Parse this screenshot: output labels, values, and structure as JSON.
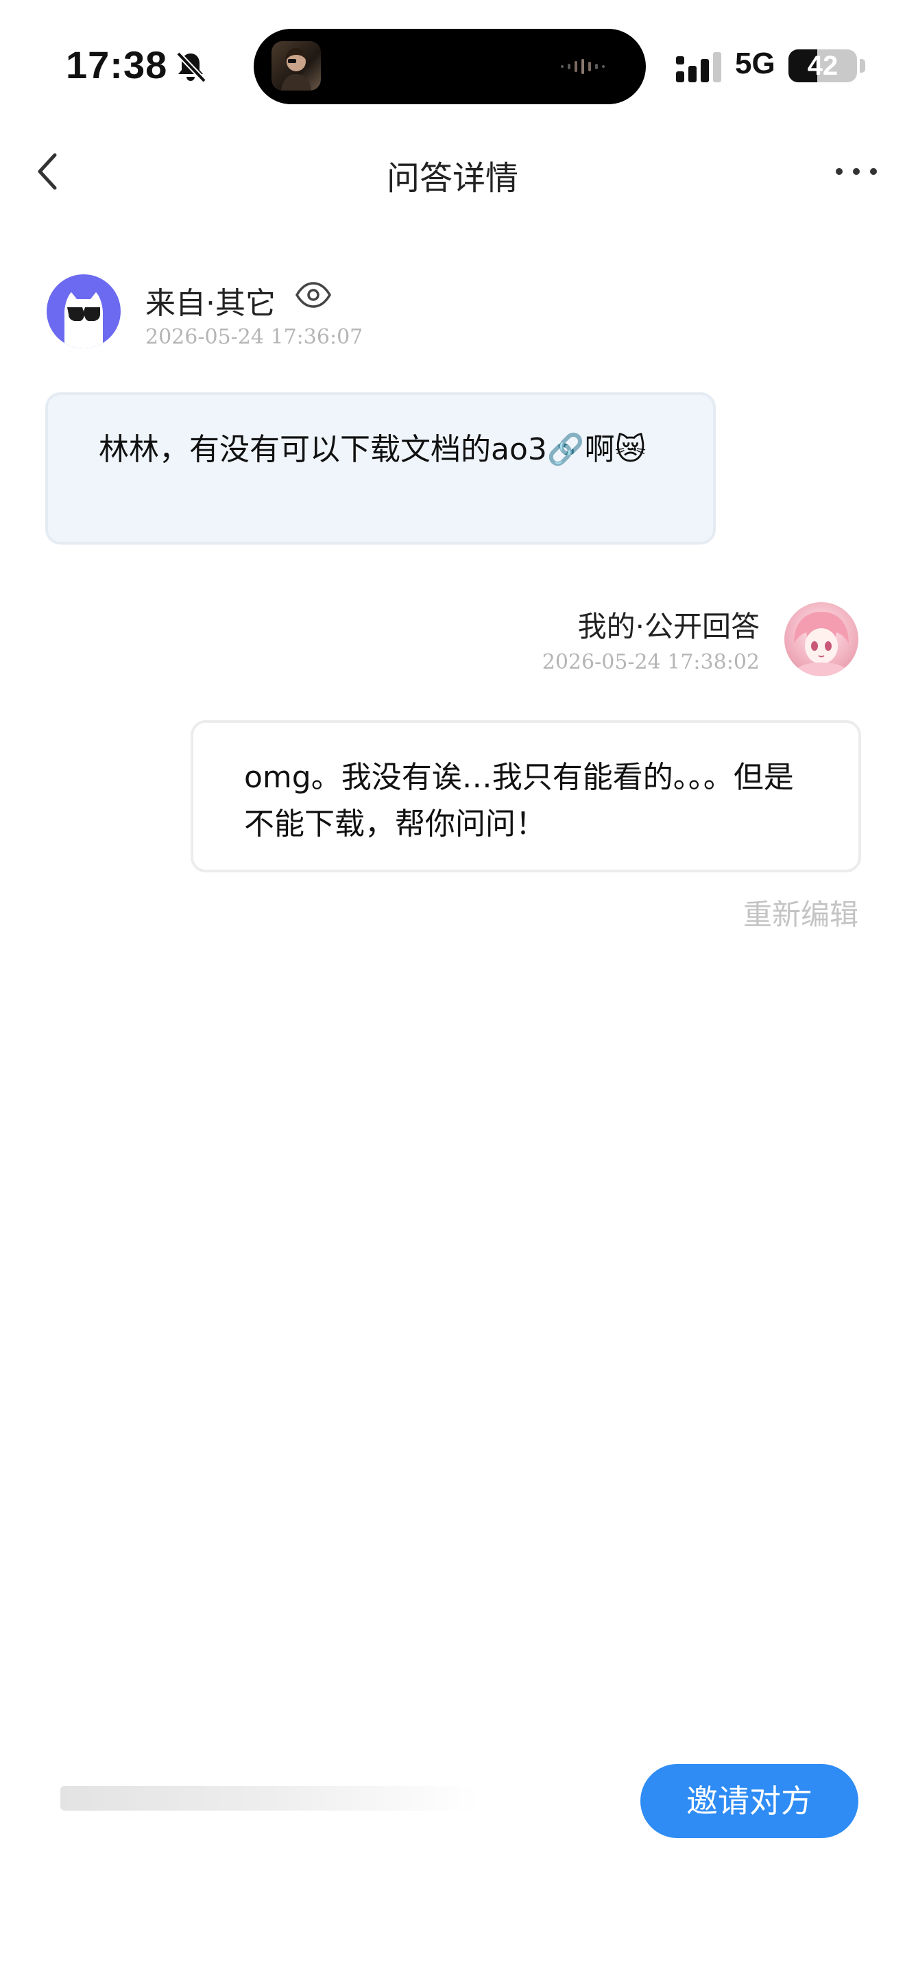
{
  "status_bar": {
    "time": "17:38",
    "network": "5G",
    "battery_level": "42",
    "battery_fraction": 0.42
  },
  "nav": {
    "title": "问答详情"
  },
  "question": {
    "source": "来自·其它",
    "time": "2026-05-24 17:36:07",
    "text": "林林，有没有可以下载文档的ao3🔗啊😿"
  },
  "answer": {
    "source": "我的·公开回答",
    "time": "2026-05-24 17:38:02",
    "text": "omg。我没有诶…我只有能看的。。。但是不能下载，帮你问问！",
    "reedit_label": "重新编辑"
  },
  "bottom": {
    "invite_label": "邀请对方"
  },
  "colors": {
    "accent": "#2f8cf5",
    "question_bubble": "#f0f5fb",
    "avatar_bg": "#6b6af0"
  }
}
